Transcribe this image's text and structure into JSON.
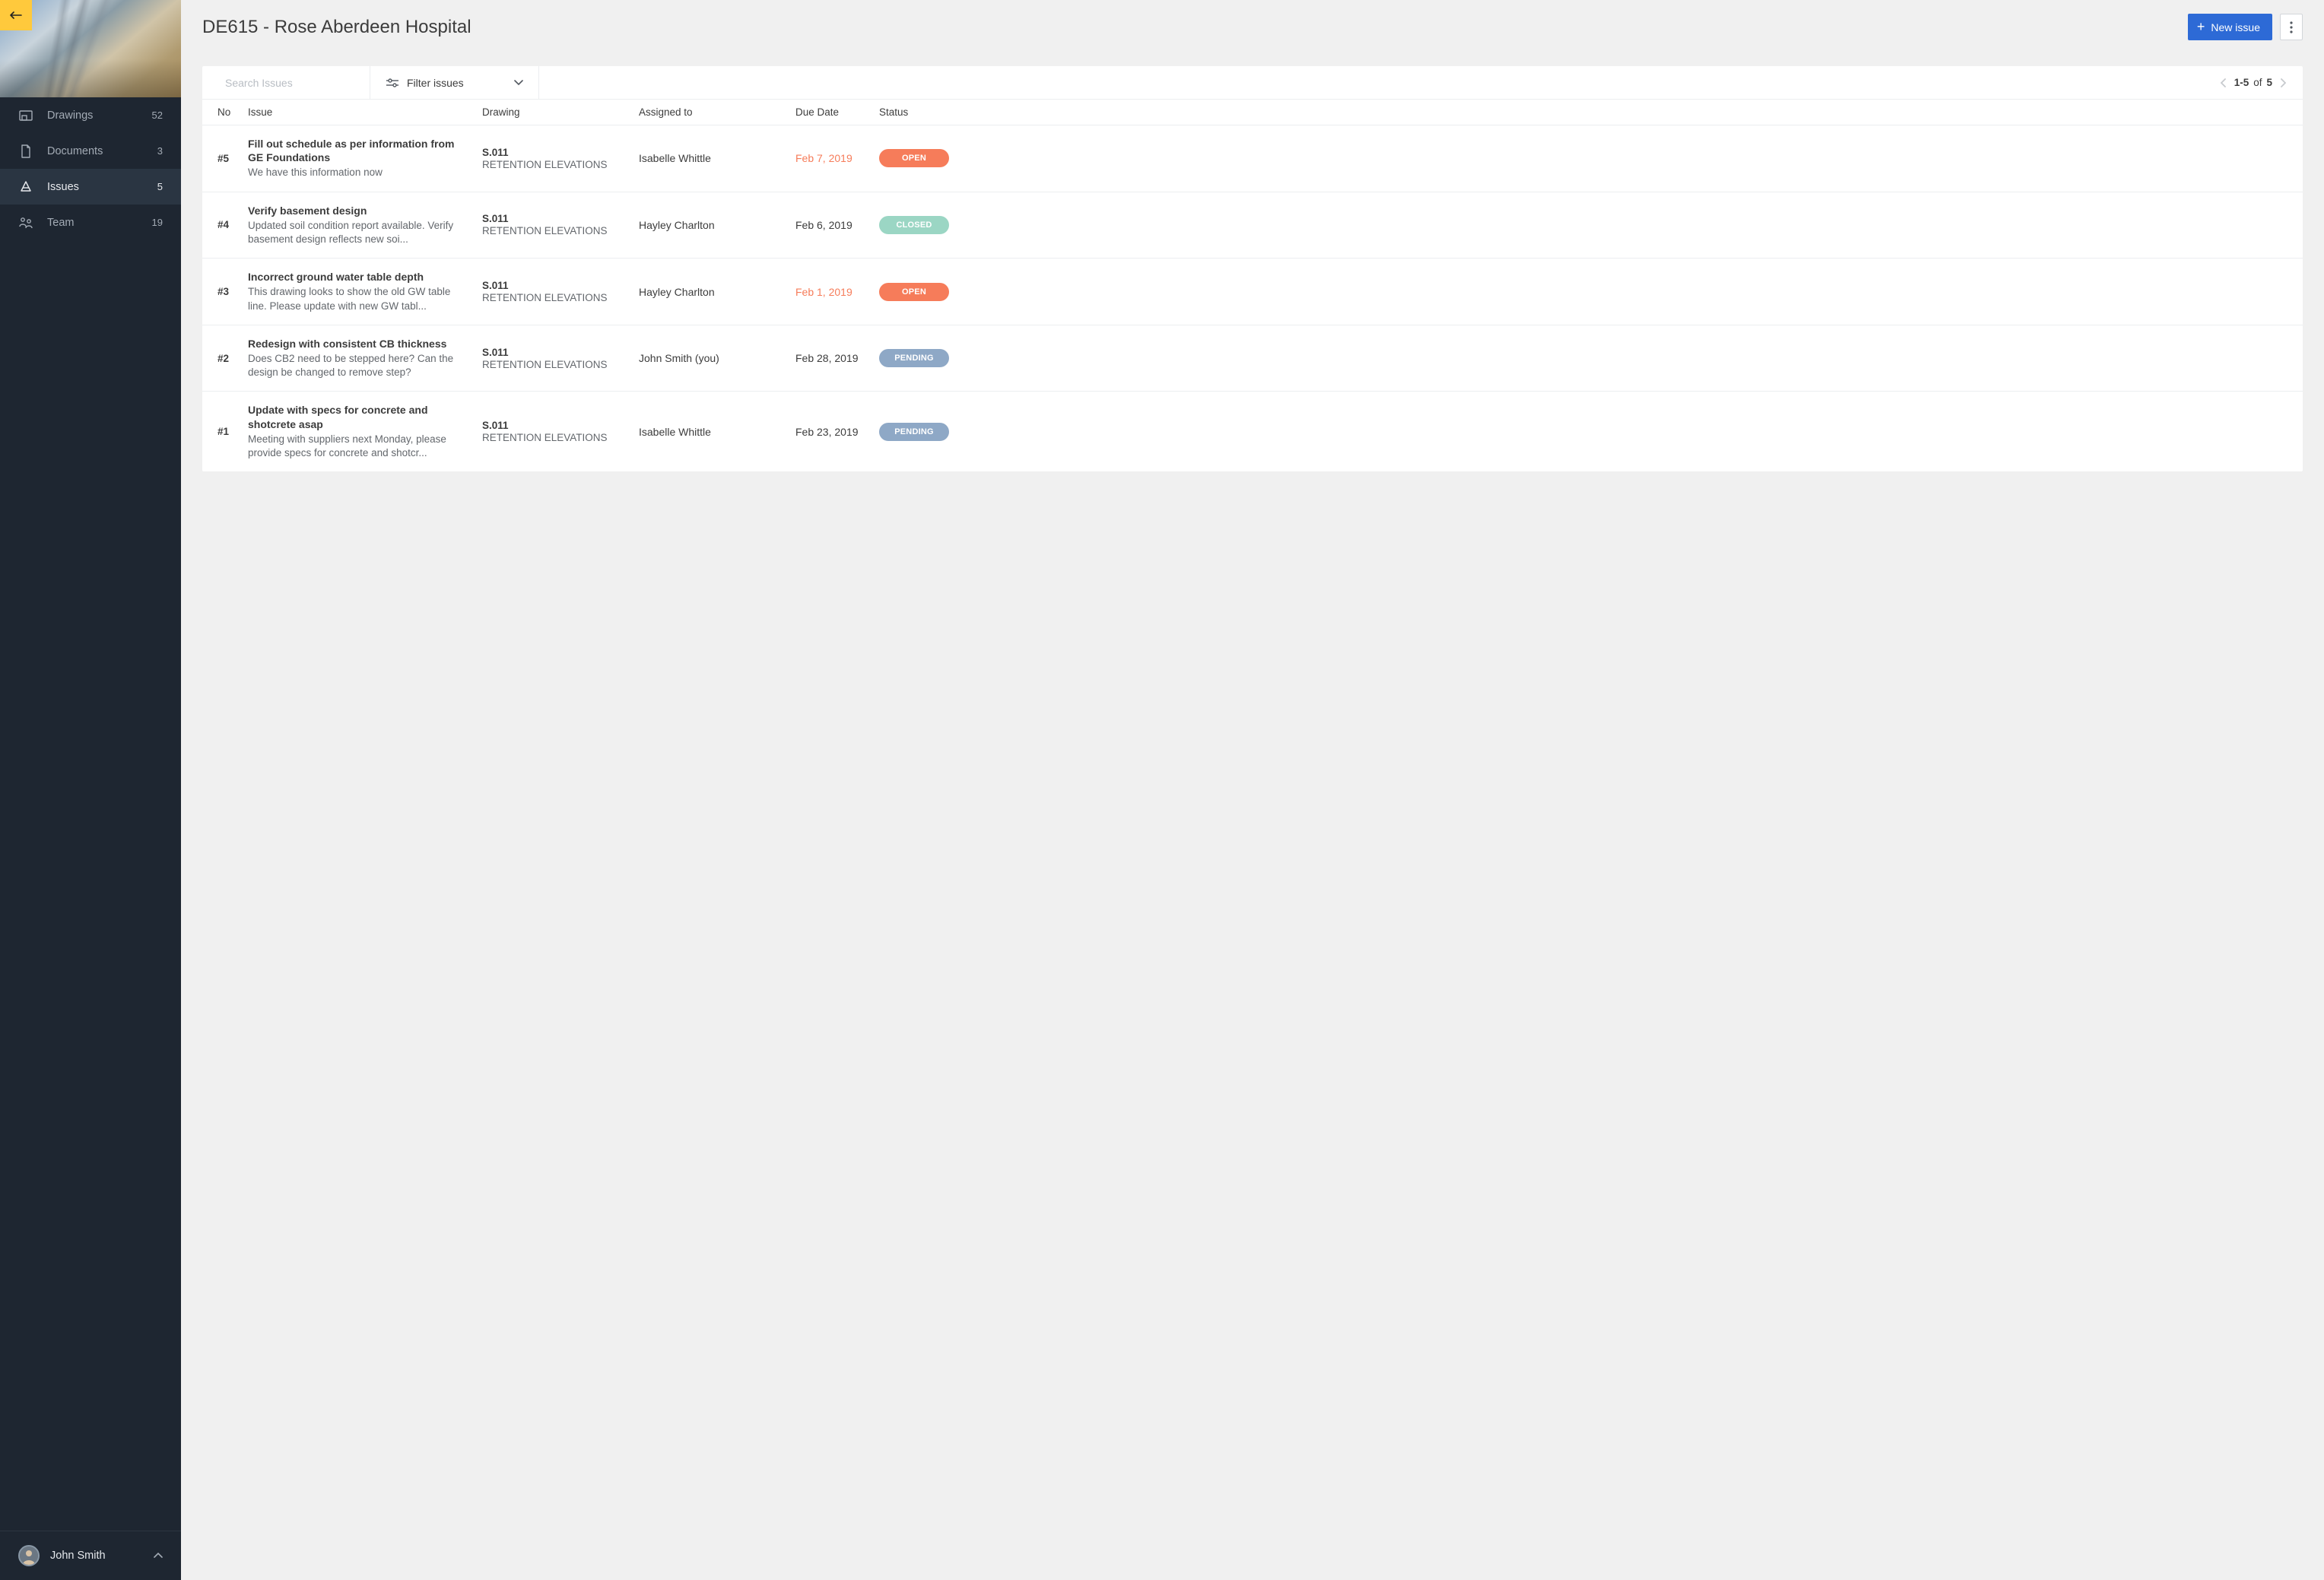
{
  "page_title": "DE615 - Rose Aberdeen Hospital",
  "header": {
    "new_issue_label": "New issue"
  },
  "sidebar": {
    "items": [
      {
        "label": "Drawings",
        "count": "52"
      },
      {
        "label": "Documents",
        "count": "3"
      },
      {
        "label": "Issues",
        "count": "5"
      },
      {
        "label": "Team",
        "count": "19"
      }
    ],
    "user_name": "John Smith"
  },
  "toolbar": {
    "search_placeholder": "Search Issues",
    "filter_label": "Filter issues",
    "page_range": "1-5",
    "page_of": "of",
    "page_total": "5"
  },
  "columns": {
    "no": "No",
    "issue": "Issue",
    "drawing": "Drawing",
    "assigned": "Assigned to",
    "due": "Due Date",
    "status": "Status"
  },
  "issues": [
    {
      "no": "#5",
      "title": "Fill out schedule as per information from GE Foundations",
      "desc": "We have this information now",
      "drawing_id": "S.011",
      "drawing_name": "RETENTION ELEVATIONS",
      "assigned": "Isabelle Whittle",
      "due": "Feb 7, 2019",
      "overdue": true,
      "status_label": "OPEN",
      "status_class": "status-open"
    },
    {
      "no": "#4",
      "title": "Verify basement design",
      "desc": "Updated soil condition report available. Verify basement design reflects new soi...",
      "drawing_id": "S.011",
      "drawing_name": "RETENTION ELEVATIONS",
      "assigned": "Hayley Charlton",
      "due": "Feb 6, 2019",
      "overdue": false,
      "status_label": "CLOSED",
      "status_class": "status-closed"
    },
    {
      "no": "#3",
      "title": "Incorrect ground water table depth",
      "desc": "This drawing looks to show the old GW table line. Please update with new GW tabl...",
      "drawing_id": "S.011",
      "drawing_name": "RETENTION ELEVATIONS",
      "assigned": "Hayley Charlton",
      "due": "Feb 1, 2019",
      "overdue": true,
      "status_label": "OPEN",
      "status_class": "status-open"
    },
    {
      "no": "#2",
      "title": "Redesign with consistent CB thickness",
      "desc": "Does CB2 need to be stepped here? Can the design be changed to remove step?",
      "drawing_id": "S.011",
      "drawing_name": "RETENTION ELEVATIONS",
      "assigned": "John Smith (you)",
      "due": "Feb 28, 2019",
      "overdue": false,
      "status_label": "PENDING",
      "status_class": "status-pending"
    },
    {
      "no": "#1",
      "title": "Update with specs for concrete and shotcrete asap",
      "desc": "Meeting with suppliers next Monday, please provide specs for concrete and shotcr...",
      "drawing_id": "S.011",
      "drawing_name": "RETENTION ELEVATIONS",
      "assigned": "Isabelle Whittle",
      "due": "Feb 23, 2019",
      "overdue": false,
      "status_label": "PENDING",
      "status_class": "status-pending"
    }
  ]
}
